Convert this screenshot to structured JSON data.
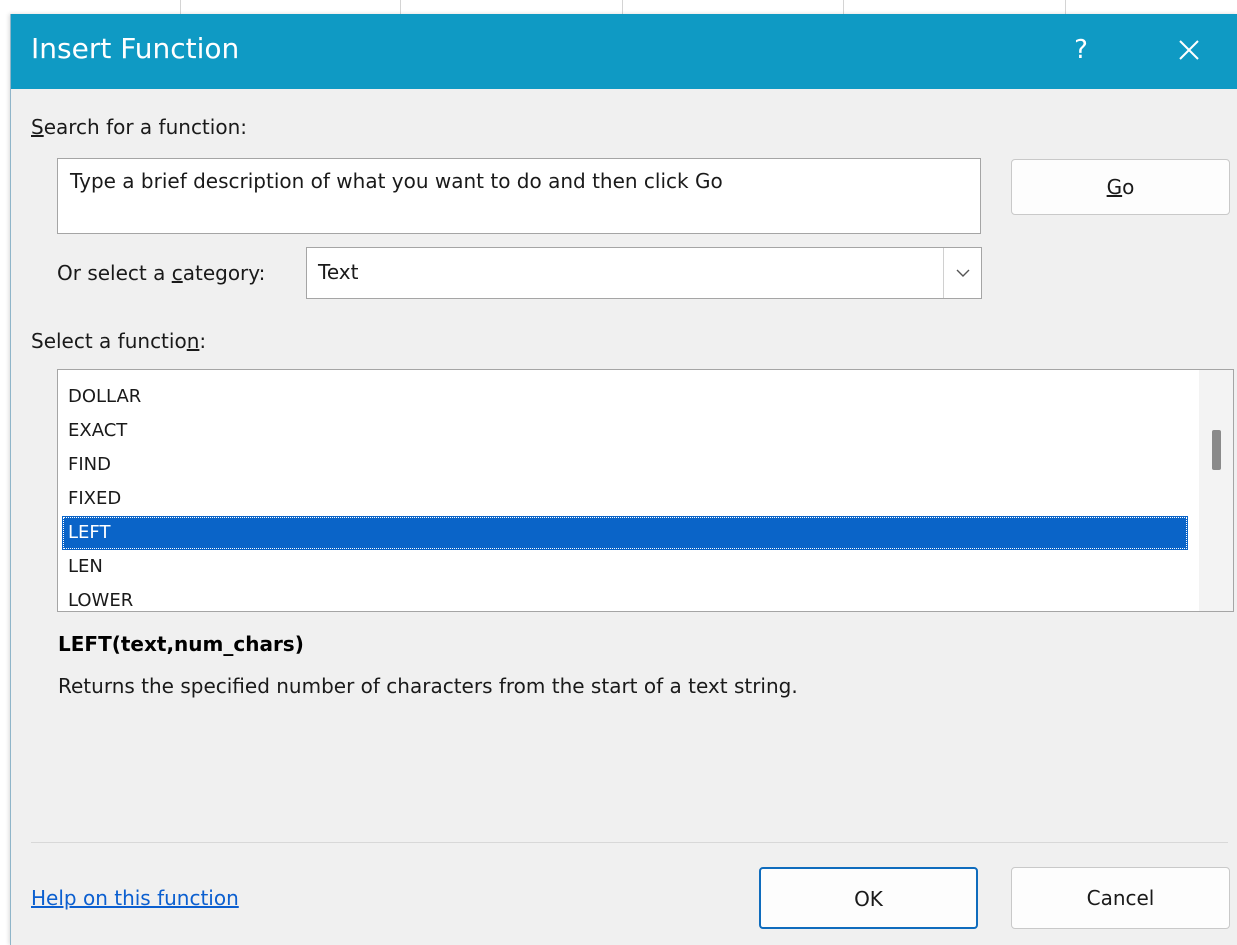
{
  "dialog": {
    "title": "Insert Function",
    "help_glyph": "?",
    "close_icon": "close-icon"
  },
  "search": {
    "label_prefix": "",
    "label_mnemonic": "S",
    "label_rest": "earch for a function:",
    "value": "Type a brief description of what you want to do and then click Go",
    "go_prefix": "",
    "go_mnemonic": "G",
    "go_rest": "o"
  },
  "category": {
    "label_prefix": "Or select a ",
    "label_mnemonic": "c",
    "label_rest": "ategory:",
    "selected": "Text",
    "arrow_icon": "chevron-down-icon"
  },
  "functions": {
    "label_prefix": "Select a functio",
    "label_mnemonic": "n",
    "label_rest": ":",
    "items": [
      "DOLLAR",
      "EXACT",
      "FIND",
      "FIXED",
      "LEFT",
      "LEN",
      "LOWER"
    ],
    "selected_index": 4,
    "scroll_fraction": 0.3
  },
  "details": {
    "signature": "LEFT(text,num_chars)",
    "description": "Returns the specified number of characters from the start of a text string."
  },
  "footer": {
    "help_link": "Help on this function",
    "ok_label": "OK",
    "cancel_label": "Cancel"
  },
  "colors": {
    "titlebar": "#0f9ac4",
    "selection": "#0a64c8",
    "link": "#0b5fd0"
  }
}
